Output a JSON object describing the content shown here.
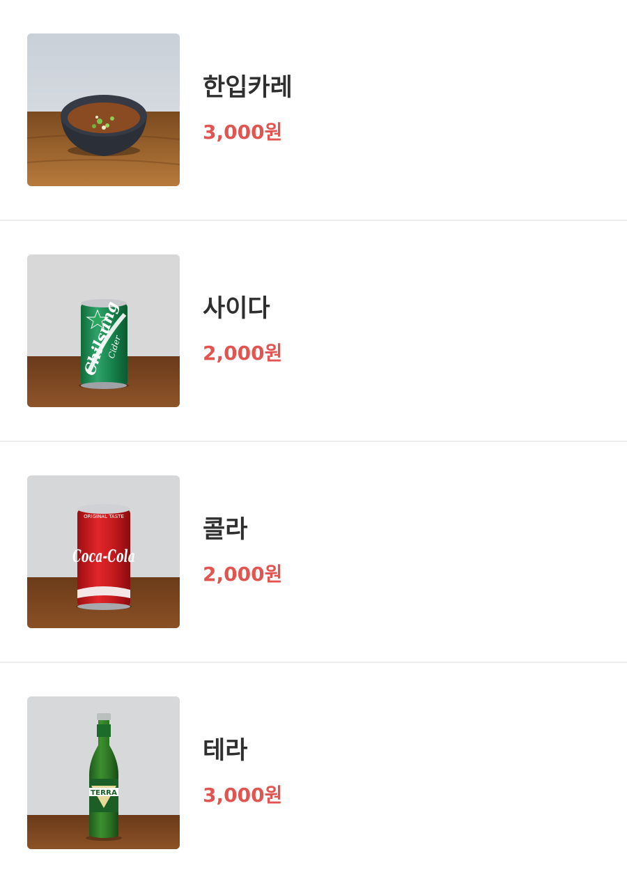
{
  "menu": {
    "items": [
      {
        "name": "한입카레",
        "price": "3,000원",
        "image": "curry-bowl-photo"
      },
      {
        "name": "사이다",
        "price": "2,000원",
        "image": "chilsung-cider-can-photo"
      },
      {
        "name": "콜라",
        "price": "2,000원",
        "image": "coca-cola-can-photo"
      },
      {
        "name": "테라",
        "price": "3,000원",
        "image": "terra-beer-bottle-photo"
      }
    ],
    "photo_text": {
      "cider_brand": "Chilsung",
      "cider_sub": "Cider",
      "cola_brand": "Coca-Cola",
      "cola_top": "ORIGINAL TASTE",
      "beer_brand": "TERRA"
    }
  },
  "colors": {
    "price": "#e2544f",
    "name": "#2f2f2f",
    "divider": "#ececec"
  }
}
